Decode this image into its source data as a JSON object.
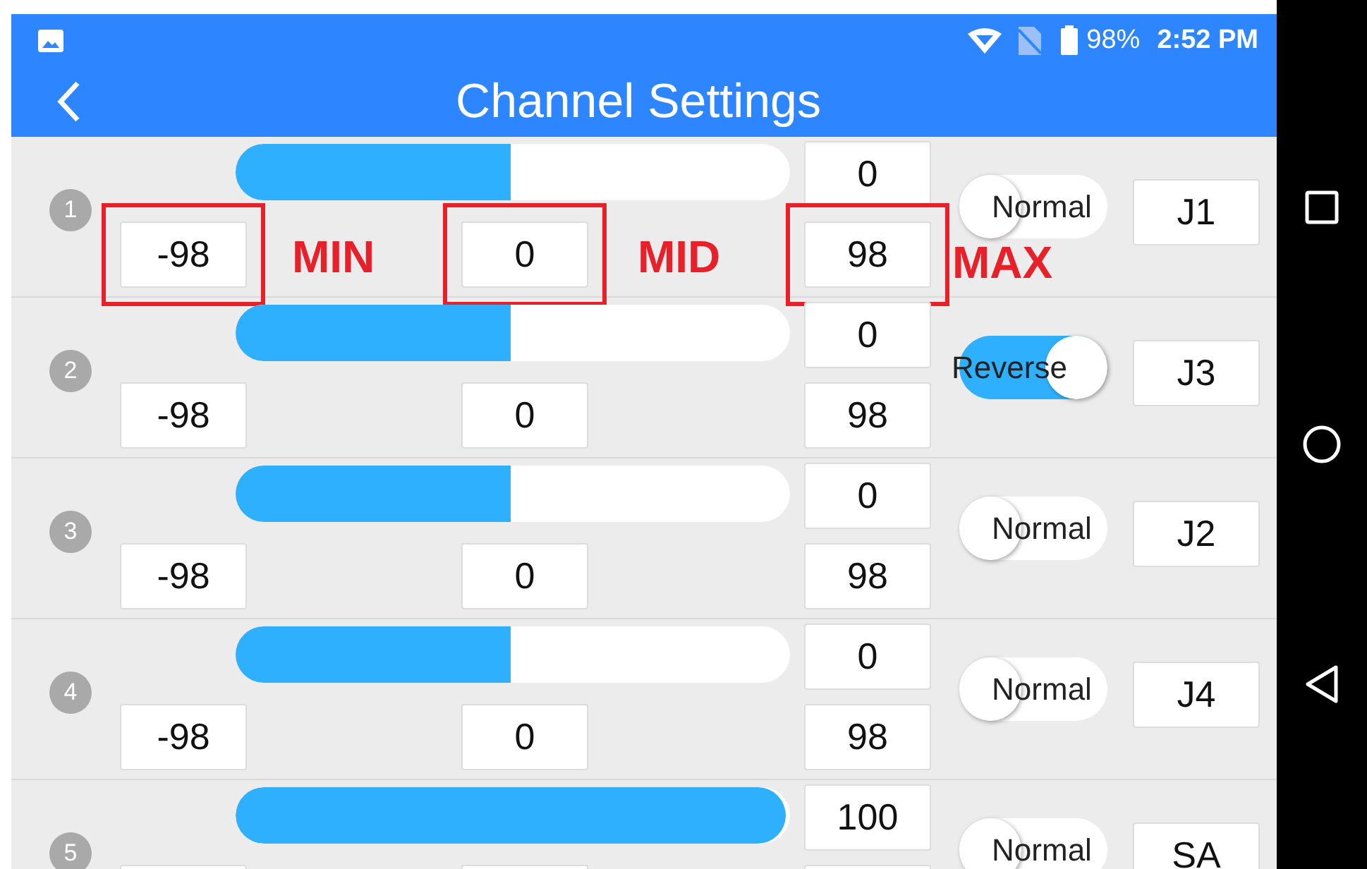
{
  "status_bar": {
    "battery": "98%",
    "time": "2:52 PM"
  },
  "header": {
    "title": "Channel Settings"
  },
  "channels": [
    {
      "number": "1",
      "level": 0.5,
      "value": "0",
      "min": {
        "value": "-98",
        "highlighted": true,
        "callout": "MIN"
      },
      "mid": {
        "value": "0",
        "highlighted": true,
        "callout": "MID"
      },
      "max": {
        "value": "98",
        "highlighted": true,
        "callout": "MAX"
      },
      "toggle": {
        "label": "Normal",
        "on": false
      },
      "source": "J1"
    },
    {
      "number": "2",
      "level": 0.5,
      "value": "0",
      "min": {
        "value": "-98",
        "highlighted": false
      },
      "mid": {
        "value": "0",
        "highlighted": false
      },
      "max": {
        "value": "98",
        "highlighted": false
      },
      "toggle": {
        "label": "Reverse",
        "on": true
      },
      "source": "J3"
    },
    {
      "number": "3",
      "level": 0.5,
      "value": "0",
      "min": {
        "value": "-98",
        "highlighted": false
      },
      "mid": {
        "value": "0",
        "highlighted": false
      },
      "max": {
        "value": "98",
        "highlighted": false
      },
      "toggle": {
        "label": "Normal",
        "on": false
      },
      "source": "J2"
    },
    {
      "number": "4",
      "level": 0.5,
      "value": "0",
      "min": {
        "value": "-98",
        "highlighted": false
      },
      "mid": {
        "value": "0",
        "highlighted": false
      },
      "max": {
        "value": "98",
        "highlighted": false
      },
      "toggle": {
        "label": "Normal",
        "on": false
      },
      "source": "J4"
    },
    {
      "number": "5",
      "level": 1,
      "value": "100",
      "min": {
        "highlighted": false
      },
      "mid": {
        "highlighted": false
      },
      "max": {
        "highlighted": false
      },
      "toggle": {
        "label": "Normal",
        "on": false
      },
      "source": "SA"
    }
  ]
}
